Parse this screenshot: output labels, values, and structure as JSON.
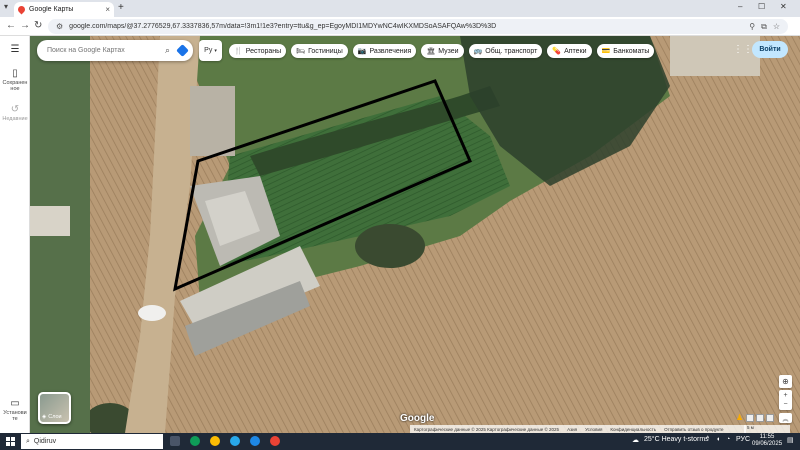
{
  "browser": {
    "tab_title": "Google Карты",
    "tab_close": "×",
    "new_tab": "+",
    "url": "google.com/maps/@37.2776529,67.3337836,57m/data=!3m1!1e3?entry=ttu&g_ep=EgoyMDI1MDYwNC4wIKXMDSoASAFQAw%3D%3D",
    "controls": {
      "minimize": "–",
      "maximize": "☐",
      "close": "✕"
    }
  },
  "sidebar": {
    "menu_icon": "menu-icon",
    "items": [
      {
        "label": "Сохранен\nное",
        "icon": "bookmark-icon"
      },
      {
        "label": "Недавние",
        "icon": "history-icon"
      },
      {
        "label": "Установи\nте",
        "icon": "phone-icon"
      }
    ]
  },
  "search": {
    "placeholder": "Поиск на Google Картах",
    "icon": "search-icon",
    "directions_icon": "directions-icon"
  },
  "lang_select": {
    "value": "Ру"
  },
  "chips": [
    {
      "label": "Рестораны",
      "icon": "restaurant-icon",
      "glyph": "🍴"
    },
    {
      "label": "Гостиницы",
      "icon": "hotel-icon",
      "glyph": "🛏"
    },
    {
      "label": "Развлечения",
      "icon": "camera-icon",
      "glyph": "📷"
    },
    {
      "label": "Музеи",
      "icon": "museum-icon",
      "glyph": "🏛"
    },
    {
      "label": "Общ. транспорт",
      "icon": "transit-icon",
      "glyph": "🚌"
    },
    {
      "label": "Аптеки",
      "icon": "pharmacy-icon",
      "glyph": "💊"
    },
    {
      "label": "Банкоматы",
      "icon": "atm-icon",
      "glyph": "💳"
    }
  ],
  "signin": {
    "label": "Войти"
  },
  "layers": {
    "label": "Слои"
  },
  "map_footer": {
    "logo": "Google",
    "attribution": "Картографические данные © 2025 Картографические данные © 2025",
    "links": [
      "Азия",
      "Условия",
      "Конфиденциальность",
      "Отправить отзыв о продукте"
    ],
    "scale": "5 м"
  },
  "taskbar": {
    "search_text": "Qidiruv",
    "weather": "25°C  Heavy t-storms",
    "lang": "РУС",
    "time": "11:55",
    "date": "09/06/2025"
  },
  "colors": {
    "outline": "#000000",
    "signin_bg": "#c2e7ff",
    "taskbar_bg": "#1f2937"
  }
}
